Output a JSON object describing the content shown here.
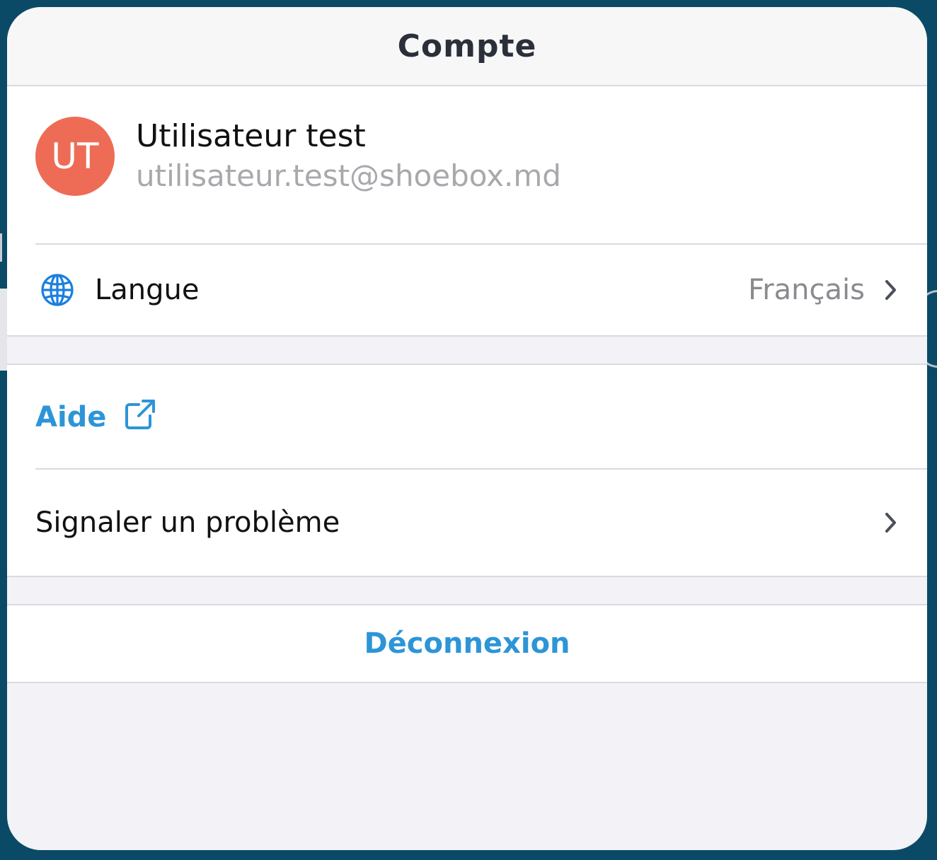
{
  "modal": {
    "title": "Compte"
  },
  "profile": {
    "initials": "UT",
    "name": "Utilisateur test",
    "email": "utilisateur.test@shoebox.md",
    "avatar_color": "#ee6c55"
  },
  "settings": {
    "language": {
      "icon": "globe-icon",
      "label": "Langue",
      "value": "Français"
    }
  },
  "support": {
    "help_label": "Aide",
    "help_icon": "external-link-icon",
    "report_label": "Signaler un problème"
  },
  "actions": {
    "logout_label": "Déconnexion"
  },
  "colors": {
    "accent": "#2d95d7",
    "globe": "#1a7fe0",
    "background": "#0b4a66"
  }
}
